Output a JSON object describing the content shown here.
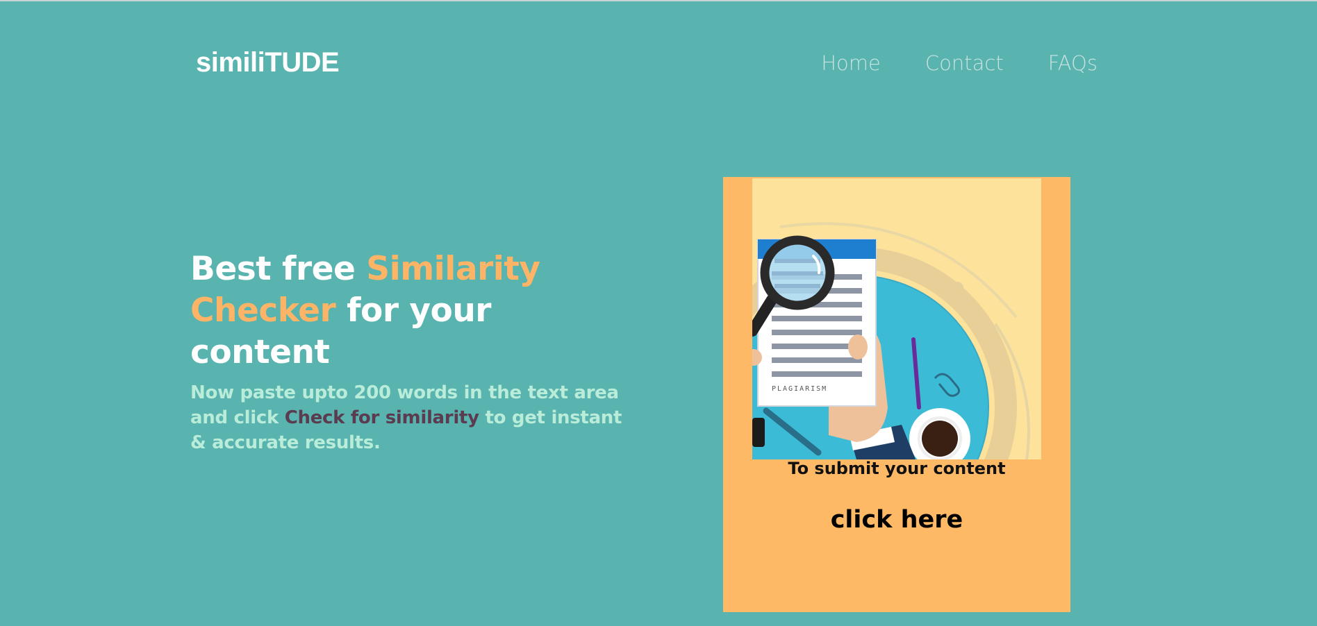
{
  "header": {
    "logo": "similiTUDE",
    "nav": [
      "Home",
      "Contact",
      "FAQs"
    ]
  },
  "hero": {
    "headline_1": "Best free ",
    "headline_accent": "Similarity Checker",
    "headline_2": " for your content",
    "sub_1": "Now paste upto 200 words in the text area and click ",
    "sub_highlight": "Check for similarity",
    "sub_2": " to get instant & accurate results."
  },
  "card": {
    "illustration_label": "PLAGIARISM",
    "caption": "To submit your content",
    "cta": "click here"
  },
  "colors": {
    "background": "#59b3ae",
    "accent": "#fdb467",
    "card": "#feb966",
    "illustration_bg": "#fde29c",
    "subtext": "#b9ecd9",
    "highlight": "#5a3b4f"
  }
}
